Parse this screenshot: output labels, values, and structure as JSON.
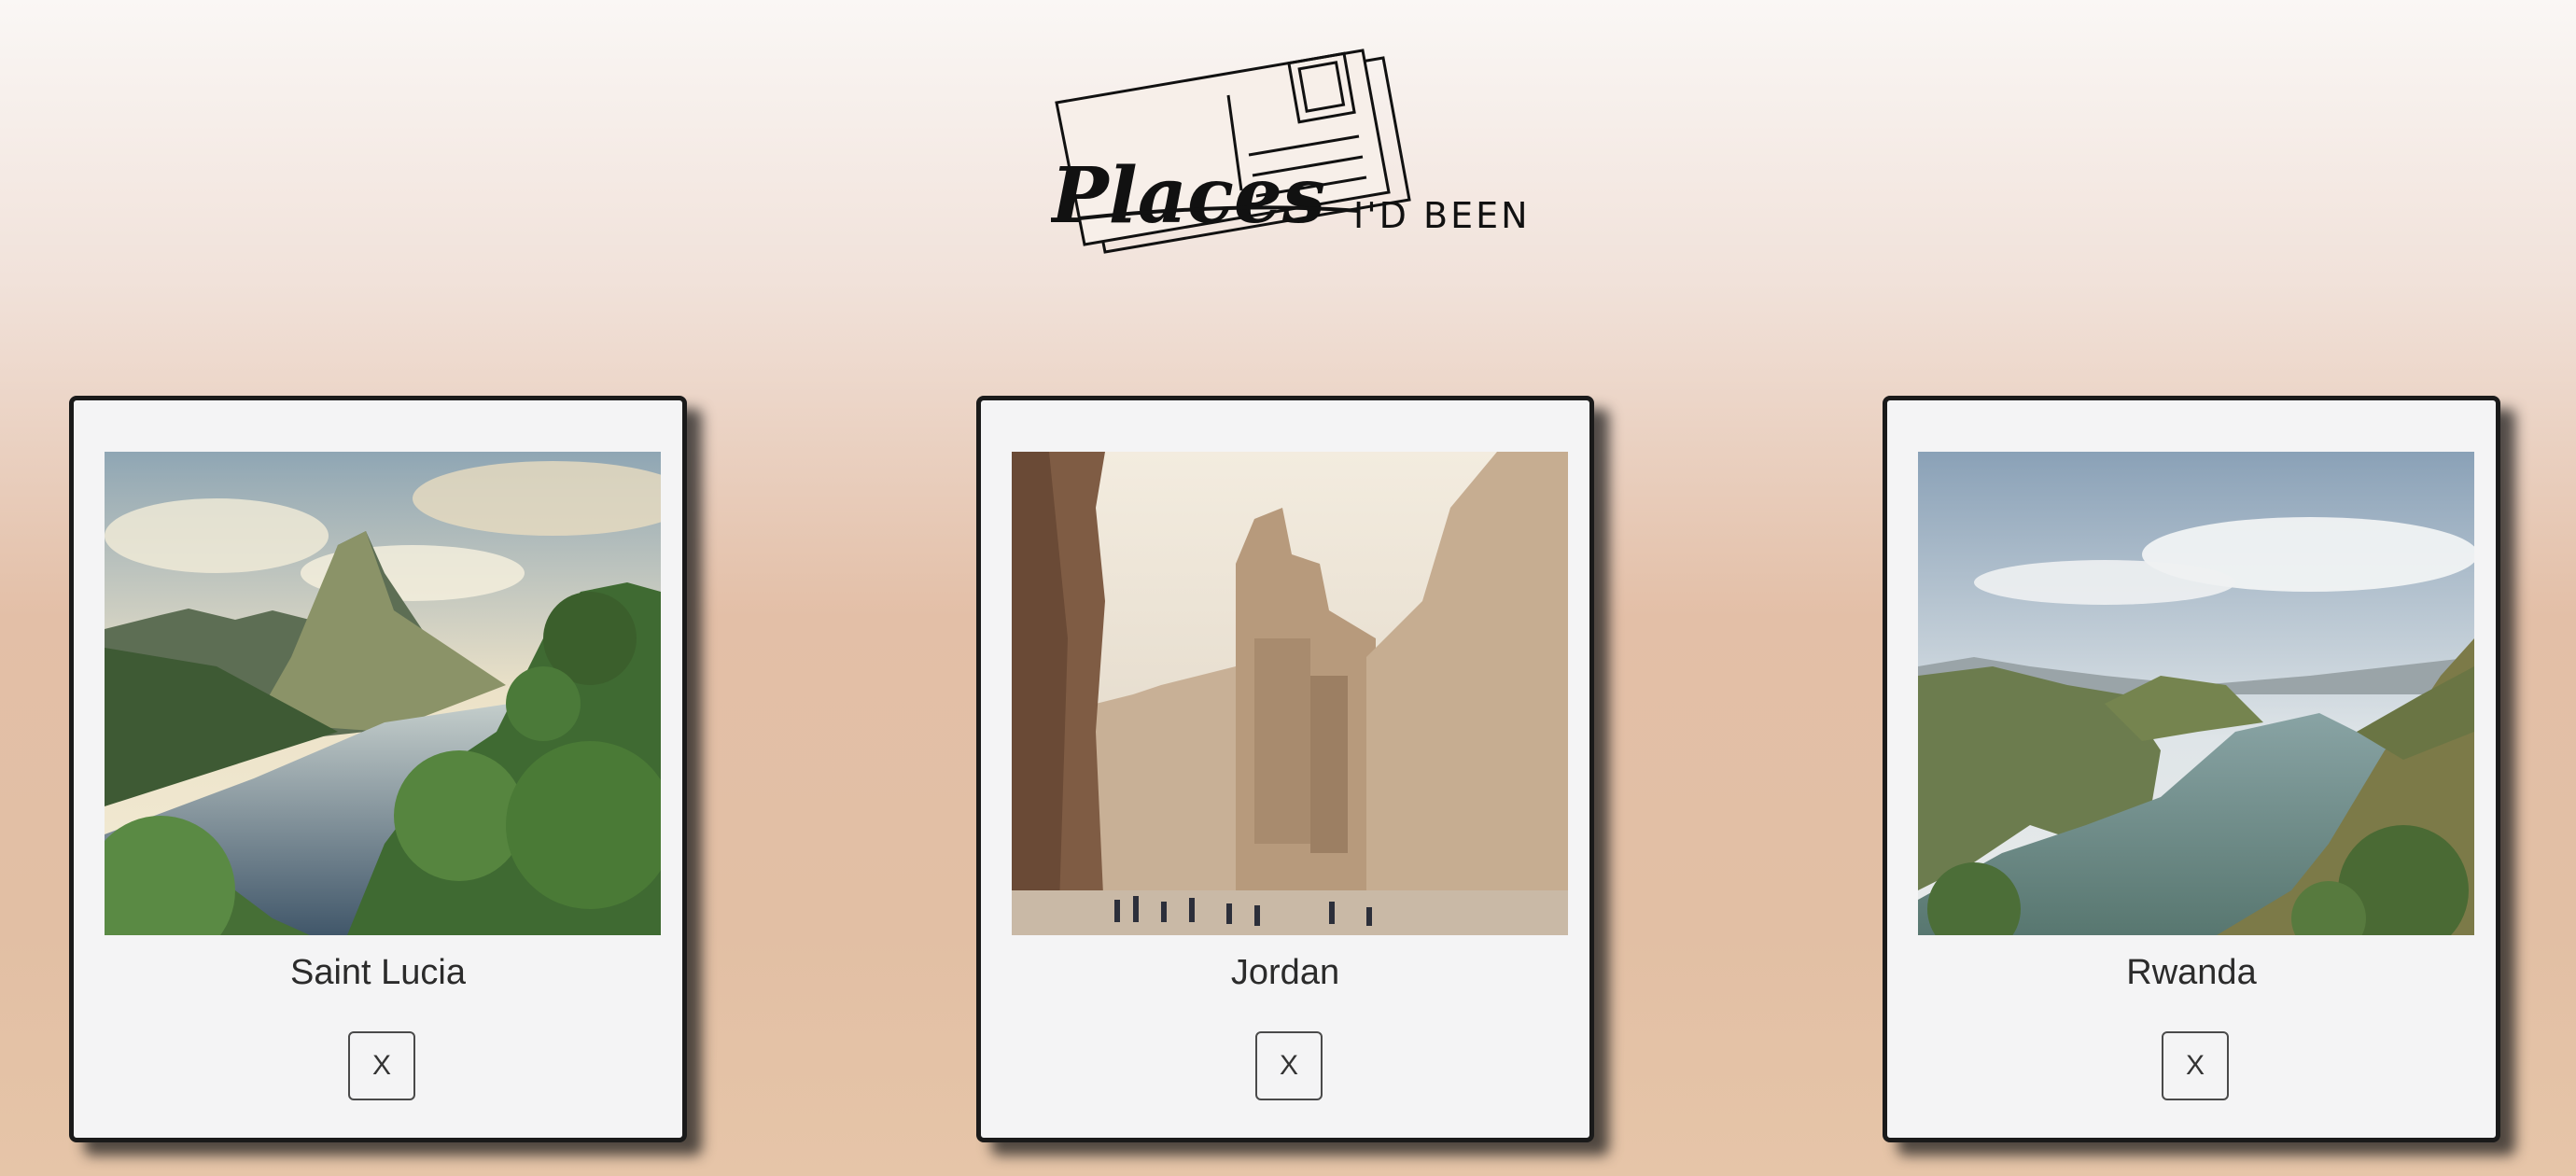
{
  "header": {
    "logo_script": "Places",
    "logo_suffix": "I'D BEEN"
  },
  "cards": [
    {
      "title": "Saint Lucia",
      "remove_label": "X",
      "image": "mountain-bay-photo"
    },
    {
      "title": "Jordan",
      "remove_label": "X",
      "image": "rock-canyon-photo"
    },
    {
      "title": "Rwanda",
      "remove_label": "X",
      "image": "lake-hills-photo"
    }
  ],
  "colors": {
    "card_background": "#f4f4f5",
    "card_border": "#1a1a1a",
    "text": "#2b2b2b"
  }
}
